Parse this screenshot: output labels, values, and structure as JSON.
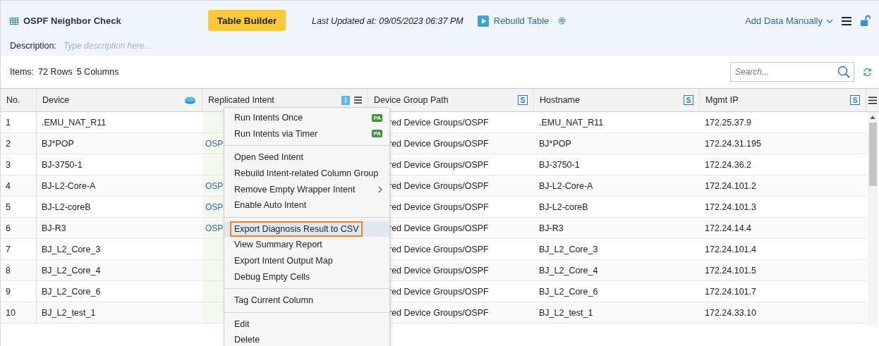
{
  "header": {
    "title": "OSPF Neighbor Check",
    "builder_button": "Table Builder",
    "last_updated": "Last Updated at: 09/05/2023 06:37 PM",
    "rebuild": "Rebuild Table",
    "add_data": "Add Data Manually",
    "description_label": "Description:",
    "description_placeholder": "Type description here..."
  },
  "summary": {
    "label": "Items:",
    "rows": "72 Rows",
    "columns": "5 Columns",
    "search_placeholder": "Search..."
  },
  "table": {
    "columns": [
      {
        "label": "No.",
        "kind": "plain"
      },
      {
        "label": "Device",
        "kind": "device"
      },
      {
        "label": "Replicated Intent",
        "kind": "intent",
        "badge": "I"
      },
      {
        "label": "Device Group Path",
        "kind": "script",
        "badge": "S"
      },
      {
        "label": "Hostname",
        "kind": "script",
        "badge": "S"
      },
      {
        "label": "Mgmt IP",
        "kind": "script",
        "badge": "S"
      }
    ],
    "rows": [
      {
        "no": "1",
        "device": ".EMU_NAT_R11",
        "group": "red Device Groups/OSPF",
        "hostname": ".EMU_NAT_R11",
        "ip": "172.25.37.9"
      },
      {
        "no": "2",
        "device": "BJ*POP",
        "intent": "OSP",
        "group": "red Device Groups/OSPF",
        "hostname": "BJ*POP",
        "ip": "172.24.31.195"
      },
      {
        "no": "3",
        "device": "BJ-3750-1",
        "group": "red Device Groups/OSPF",
        "hostname": "BJ-3750-1",
        "ip": "172.24.36.2"
      },
      {
        "no": "4",
        "device": "BJ-L2-Core-A",
        "intent": "OSP",
        "group": "red Device Groups/OSPF",
        "hostname": "BJ-L2-Core-A",
        "ip": "172.24.101.2"
      },
      {
        "no": "5",
        "device": "BJ-L2-coreB",
        "intent": "OSP",
        "group": "red Device Groups/OSPF",
        "hostname": "BJ-L2-coreB",
        "ip": "172.24.101.3"
      },
      {
        "no": "6",
        "device": "BJ-R3",
        "intent": "OSP",
        "group": "red Device Groups/OSPF",
        "hostname": "BJ-R3",
        "ip": "172.24.14.4"
      },
      {
        "no": "7",
        "device": "BJ_L2_Core_3",
        "group": "red Device Groups/OSPF",
        "hostname": "BJ_L2_Core_3",
        "ip": "172.24.101.4"
      },
      {
        "no": "8",
        "device": "BJ_L2_Core_4",
        "group": "red Device Groups/OSPF",
        "hostname": "BJ_L2_Core_4",
        "ip": "172.24.101.5"
      },
      {
        "no": "9",
        "device": "BJ_L2_Core_6",
        "group": "red Device Groups/OSPF",
        "hostname": "BJ_L2_Core_6",
        "ip": "172.24.101.7"
      },
      {
        "no": "10",
        "device": "BJ_L2_test_1",
        "group": "red Device Groups/OSPF",
        "hostname": "BJ_L2_test_1",
        "ip": "172.24.33.10"
      }
    ]
  },
  "context_menu": {
    "groups": [
      [
        {
          "label": "Run Intents Once",
          "selected": false,
          "badge": "PA",
          "submenu": false
        },
        {
          "label": "Run Intents via Timer",
          "selected": false,
          "badge": "PA",
          "submenu": false
        }
      ],
      [
        {
          "label": "Open Seed Intent",
          "selected": false,
          "submenu": false
        },
        {
          "label": "Rebuild Intent-related Column Group",
          "selected": false,
          "submenu": false
        },
        {
          "label": "Remove Empty Wrapper Intent",
          "selected": false,
          "submenu": true
        },
        {
          "label": "Enable Auto Intent",
          "selected": false,
          "submenu": false
        }
      ],
      [
        {
          "label": "Export Diagnosis Result to CSV",
          "selected": true,
          "submenu": false
        },
        {
          "label": "View Summary Report",
          "selected": false,
          "submenu": false
        },
        {
          "label": "Export Intent Output Map",
          "selected": false,
          "submenu": false
        },
        {
          "label": "Debug Empty Cells",
          "selected": false,
          "submenu": false
        }
      ],
      [
        {
          "label": "Tag Current Column",
          "selected": false,
          "submenu": false
        }
      ],
      [
        {
          "label": "Edit",
          "selected": false,
          "submenu": false
        },
        {
          "label": "Delete",
          "selected": false,
          "submenu": false
        }
      ]
    ]
  }
}
